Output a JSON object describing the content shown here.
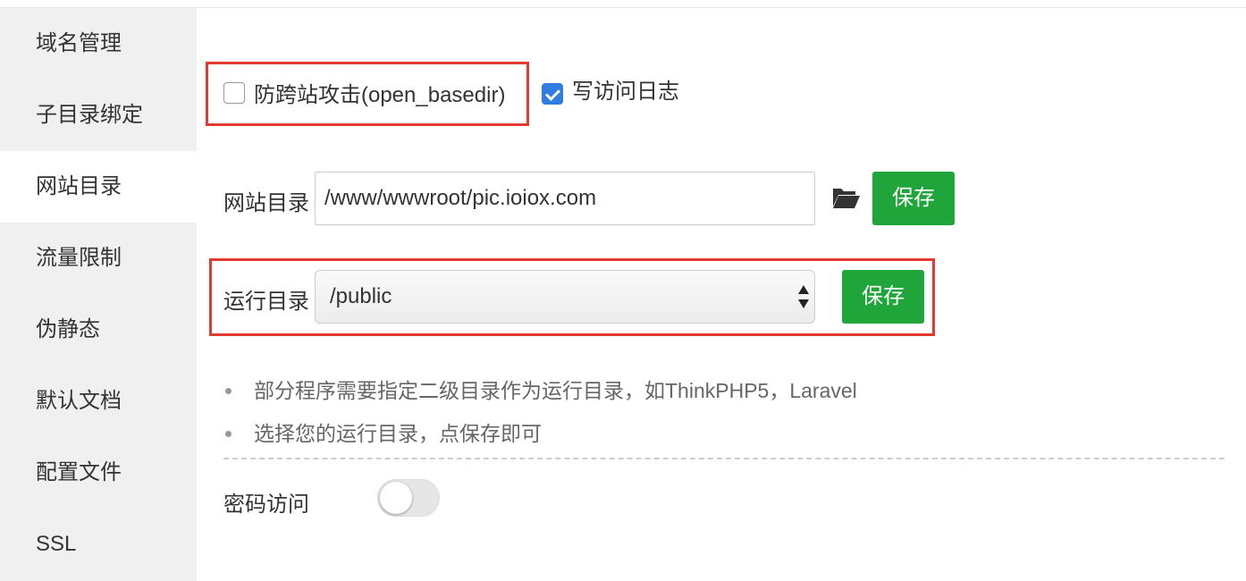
{
  "sidebar": {
    "items": [
      {
        "label": "域名管理",
        "active": false
      },
      {
        "label": "子目录绑定",
        "active": false
      },
      {
        "label": "网站目录",
        "active": true
      },
      {
        "label": "流量限制",
        "active": false
      },
      {
        "label": "伪静态",
        "active": false
      },
      {
        "label": "默认文档",
        "active": false
      },
      {
        "label": "配置文件",
        "active": false
      },
      {
        "label": "SSL",
        "active": false
      }
    ]
  },
  "options": {
    "anti_xss": {
      "label": "防跨站攻击(open_basedir)",
      "checked": false
    },
    "access_log": {
      "label": "写访问日志",
      "checked": true
    }
  },
  "site_dir": {
    "label": "网站目录",
    "value": "/www/wwwroot/pic.ioiox.com",
    "folder_icon": "folder-open-icon",
    "save_label": "保存"
  },
  "run_dir": {
    "label": "运行目录",
    "selected": "/public",
    "save_label": "保存"
  },
  "tips": [
    "部分程序需要指定二级目录作为运行目录，如ThinkPHP5，Laravel",
    "选择您的运行目录，点保存即可"
  ],
  "password_access": {
    "label": "密码访问",
    "enabled": false
  },
  "colors": {
    "highlight_border": "#e03a32",
    "save_button": "#20a53a",
    "checkbox_checked": "#2f7de1",
    "sidebar_bg": "#f0f0f0"
  }
}
